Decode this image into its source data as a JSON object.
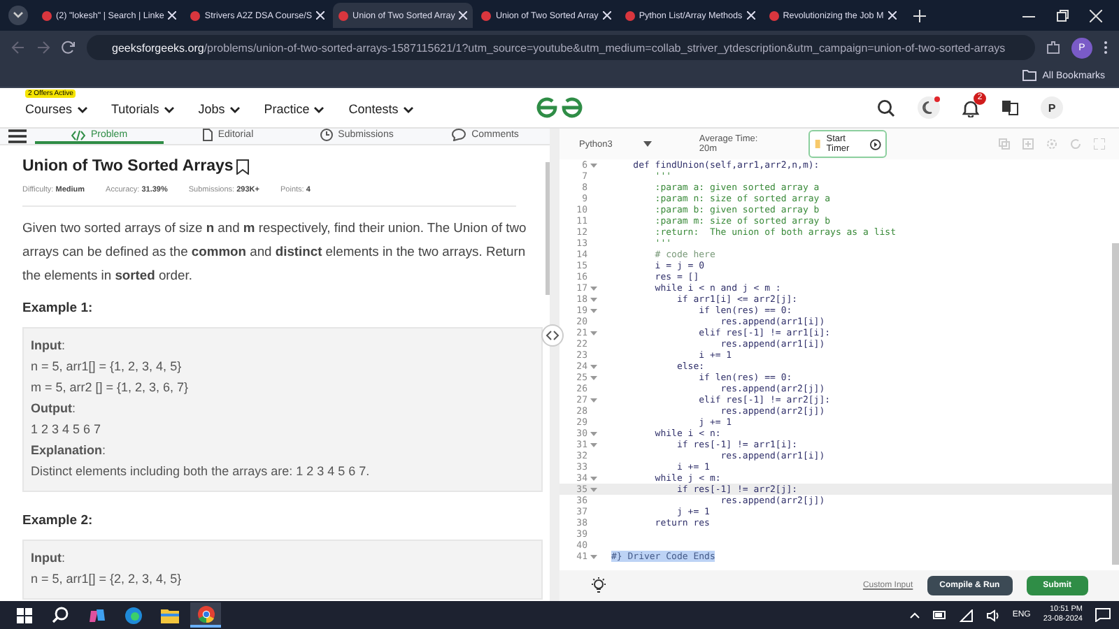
{
  "browser": {
    "tabs": [
      {
        "title": "(2) \"lokesh\" | Search | Linke",
        "selected": false
      },
      {
        "title": "Strivers A2Z DSA Course/S",
        "selected": false
      },
      {
        "title": "Union of Two Sorted Array",
        "selected": true
      },
      {
        "title": "Union of Two Sorted Array",
        "selected": false
      },
      {
        "title": "Python List/Array Methods",
        "selected": false
      },
      {
        "title": "Revolutionizing the Job M",
        "selected": false
      }
    ],
    "address": {
      "domain": "geeksforgeeks.org",
      "path": "/problems/union-of-two-sorted-arrays-1587115621/1?utm_source=youtube&utm_medium=collab_striver_ytdescription&utm_campaign=union-of-two-sorted-arrays"
    },
    "profile": "P",
    "bookmarks": "All Bookmarks"
  },
  "site_nav": {
    "offer_badge": "2 Offers Active",
    "items": [
      "Courses",
      "Tutorials",
      "Jobs",
      "Practice",
      "Contests"
    ],
    "notification_count": "2",
    "avatar": "P"
  },
  "problem_tabs": [
    {
      "label": "Problem",
      "selected": true
    },
    {
      "label": "Editorial",
      "selected": false
    },
    {
      "label": "Submissions",
      "selected": false
    },
    {
      "label": "Comments",
      "selected": false
    }
  ],
  "problem": {
    "title": "Union of Two Sorted Arrays",
    "meta": [
      {
        "label": "Difficulty:",
        "value": "Medium"
      },
      {
        "label": "Accuracy:",
        "value": "31.39%"
      },
      {
        "label": "Submissions:",
        "value": "293K+"
      },
      {
        "label": "Points:",
        "value": "4"
      }
    ],
    "description": "Given two sorted arrays of size **n** and **m** respectively, find their union. The Union of two arrays can be defined as the **common** and **distinct** elements in the two arrays. Return the elements in **sorted** order.",
    "examples": [
      {
        "title": "Example 1:",
        "lines": [
          "**Input**:",
          "n = 5, arr1[] = {1, 2, 3, 4, 5}",
          "m = 5, arr2 [] = {1, 2, 3, 6, 7}",
          "**Output**:",
          "1 2 3 4 5 6 7",
          "**Explanation**:",
          "Distinct elements including both the arrays are: 1 2 3 4 5 6 7."
        ]
      },
      {
        "title": "Example 2:",
        "lines": [
          "**Input**:",
          "n = 5, arr1[] = {2, 2, 3, 4, 5}"
        ]
      }
    ]
  },
  "editor": {
    "language": "Python3",
    "average_time": "Average Time: 20m",
    "start_timer": "Start Timer",
    "lines": [
      {
        "no": "6",
        "fold": true,
        "kind": "code",
        "active": false,
        "text": "    def findUnion(self,arr1,arr2,n,m):"
      },
      {
        "no": "7",
        "fold": false,
        "kind": "doc",
        "active": false,
        "text": "        '''"
      },
      {
        "no": "8",
        "fold": false,
        "kind": "doc",
        "active": false,
        "text": "        :param a: given sorted array a"
      },
      {
        "no": "9",
        "fold": false,
        "kind": "doc",
        "active": false,
        "text": "        :param n: size of sorted array a"
      },
      {
        "no": "10",
        "fold": false,
        "kind": "doc",
        "active": false,
        "text": "        :param b: given sorted array b"
      },
      {
        "no": "11",
        "fold": false,
        "kind": "doc",
        "active": false,
        "text": "        :param m: size of sorted array b"
      },
      {
        "no": "12",
        "fold": false,
        "kind": "doc",
        "active": false,
        "text": "        :return:  The union of both arrays as a list"
      },
      {
        "no": "13",
        "fold": false,
        "kind": "doc",
        "active": false,
        "text": "        '''"
      },
      {
        "no": "14",
        "fold": false,
        "kind": "comment",
        "active": false,
        "text": "        # code here"
      },
      {
        "no": "15",
        "fold": false,
        "kind": "code",
        "active": false,
        "text": "        i = j = 0"
      },
      {
        "no": "16",
        "fold": false,
        "kind": "code",
        "active": false,
        "text": "        res = []"
      },
      {
        "no": "17",
        "fold": true,
        "kind": "code",
        "active": false,
        "text": "        while i < n and j < m :"
      },
      {
        "no": "18",
        "fold": true,
        "kind": "code",
        "active": false,
        "text": "            if arr1[i] <= arr2[j]:"
      },
      {
        "no": "19",
        "fold": true,
        "kind": "code",
        "active": false,
        "text": "                if len(res) == 0:"
      },
      {
        "no": "20",
        "fold": false,
        "kind": "code",
        "active": false,
        "text": "                    res.append(arr1[i])"
      },
      {
        "no": "21",
        "fold": true,
        "kind": "code",
        "active": false,
        "text": "                elif res[-1] != arr1[i]:"
      },
      {
        "no": "22",
        "fold": false,
        "kind": "code",
        "active": false,
        "text": "                    res.append(arr1[i])"
      },
      {
        "no": "23",
        "fold": false,
        "kind": "code",
        "active": false,
        "text": "                i += 1"
      },
      {
        "no": "24",
        "fold": true,
        "kind": "code",
        "active": false,
        "text": "            else:"
      },
      {
        "no": "25",
        "fold": true,
        "kind": "code",
        "active": false,
        "text": "                if len(res) == 0:"
      },
      {
        "no": "26",
        "fold": false,
        "kind": "code",
        "active": false,
        "text": "                    res.append(arr2[j])"
      },
      {
        "no": "27",
        "fold": true,
        "kind": "code",
        "active": false,
        "text": "                elif res[-1] != arr2[j]:"
      },
      {
        "no": "28",
        "fold": false,
        "kind": "code",
        "active": false,
        "text": "                    res.append(arr2[j])"
      },
      {
        "no": "29",
        "fold": false,
        "kind": "code",
        "active": false,
        "text": "                j += 1"
      },
      {
        "no": "30",
        "fold": true,
        "kind": "code",
        "active": false,
        "text": "        while i < n:"
      },
      {
        "no": "31",
        "fold": true,
        "kind": "code",
        "active": false,
        "text": "            if res[-1] != arr1[i]:"
      },
      {
        "no": "32",
        "fold": false,
        "kind": "code",
        "active": false,
        "text": "                    res.append(arr1[i])"
      },
      {
        "no": "33",
        "fold": false,
        "kind": "code",
        "active": false,
        "text": "            i += 1"
      },
      {
        "no": "34",
        "fold": true,
        "kind": "code",
        "active": false,
        "text": "        while j < m:"
      },
      {
        "no": "35",
        "fold": true,
        "kind": "code",
        "active": true,
        "text": "            if res[-1] != arr2[j]:"
      },
      {
        "no": "36",
        "fold": false,
        "kind": "code",
        "active": false,
        "text": "                    res.append(arr2[j])"
      },
      {
        "no": "37",
        "fold": false,
        "kind": "code",
        "active": false,
        "text": "            j += 1"
      },
      {
        "no": "38",
        "fold": false,
        "kind": "code",
        "active": false,
        "text": "        return res"
      },
      {
        "no": "39",
        "fold": false,
        "active": false
      },
      {
        "no": "40",
        "fold": false,
        "active": false
      },
      {
        "no": "41",
        "fold": true,
        "kind": "selected",
        "active": false,
        "text": "#} Driver Code Ends"
      }
    ],
    "custom_input": "Custom Input",
    "compile_run": "Compile & Run",
    "submit": "Submit"
  },
  "taskbar": {
    "language": "ENG",
    "time": "10:51 PM",
    "date": "23-08-2024"
  }
}
